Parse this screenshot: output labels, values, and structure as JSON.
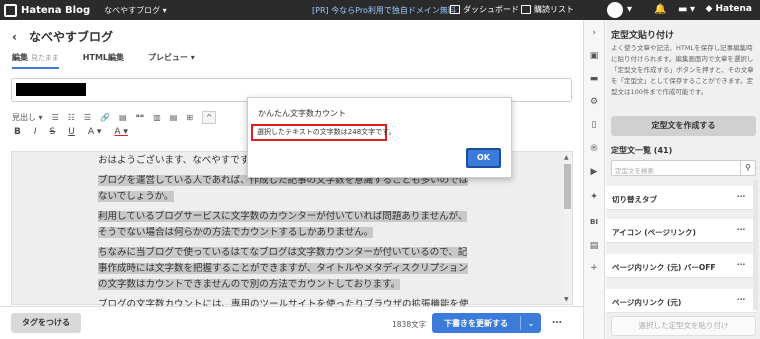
{
  "topbar": {
    "brand": "Hatena Blog",
    "blog_menu": "なべやすブログ ▾",
    "pro_link": "[PR] 今ならPro利用で独自ドメイン無料",
    "dashboard": "ダッシュボード",
    "reader": "購読リスト",
    "hatena": "◆ Hatena"
  },
  "editor": {
    "back": "‹",
    "title": "なべやすブログ",
    "tabs": [
      {
        "label": "編集",
        "sub": "見たまま"
      },
      {
        "label": "HTML編集"
      },
      {
        "label": "プレビュー ▾"
      }
    ],
    "toolbar1": [
      "見出し ▾",
      "☰",
      "☷",
      "☰",
      "🔗",
      "▤",
      "❝❝",
      "▥",
      "▤",
      "⊞",
      "^"
    ],
    "toolbar2": [
      "B",
      "I",
      "S",
      "U",
      "A ▾",
      "A ▾"
    ],
    "paragraphs": [
      "おはようございます、なべやすです。",
      "ブログを運営している人であれば、作成した記事の文字数を意識することも多いのではないでしょうか。",
      "利用しているブログサービスに文字数のカウンターが付いていれば問題ありませんが、そうでない場合は何らかの方法でカウントするしかありません。",
      "ちなみに当ブログで使っているはてなブログは文字数カウンターが付いているので、記事作成時には文字数を把握することができますが、タイトルやメタディスクリプションの文字数はカウントできませんので別の方法でカウントしております。",
      "ブログの文字数カウントには、専用のツールサイトを使ったりブラウザの拡張機能を使"
    ]
  },
  "bottom": {
    "tag_button": "タグをつける",
    "char_count": "1838文字",
    "update_button": "下書きを更新する",
    "more": "…"
  },
  "dialog": {
    "title": "かんたん文字数カウント",
    "message": "選択したテキストの文字数は248文字です。",
    "ok": "OK"
  },
  "right_panel": {
    "title": "定型文貼り付け",
    "description": "よく使う文章や記法、HTMLを保存し記事編集時に貼り付けられます。編集画面内で文章を選択し「定型文を作成する」ボタンを押すと、その文章を「定型文」として保存することができます。定型文は100件まで作成可能です。",
    "create_button": "定型文を作成する",
    "list_heading": "定型文一覧 (41)",
    "search_placeholder": "定型文を検索",
    "items": [
      {
        "label": "切り替えタブ"
      },
      {
        "label": "アイコン (ページリンク)"
      },
      {
        "label": "ページ内リンク (元) バーOFF"
      },
      {
        "label": "ページ内リンク (元)"
      }
    ],
    "paste_button": "選択した定型文を貼り付け"
  },
  "sidebar_icons": [
    "chevron-right-icon",
    "preview-icon",
    "folder-icon",
    "gear-icon",
    "document-icon",
    "r-icon",
    "youtube-icon",
    "twitter-icon",
    "bi-icon",
    "clipboard-icon",
    "plus-icon"
  ]
}
